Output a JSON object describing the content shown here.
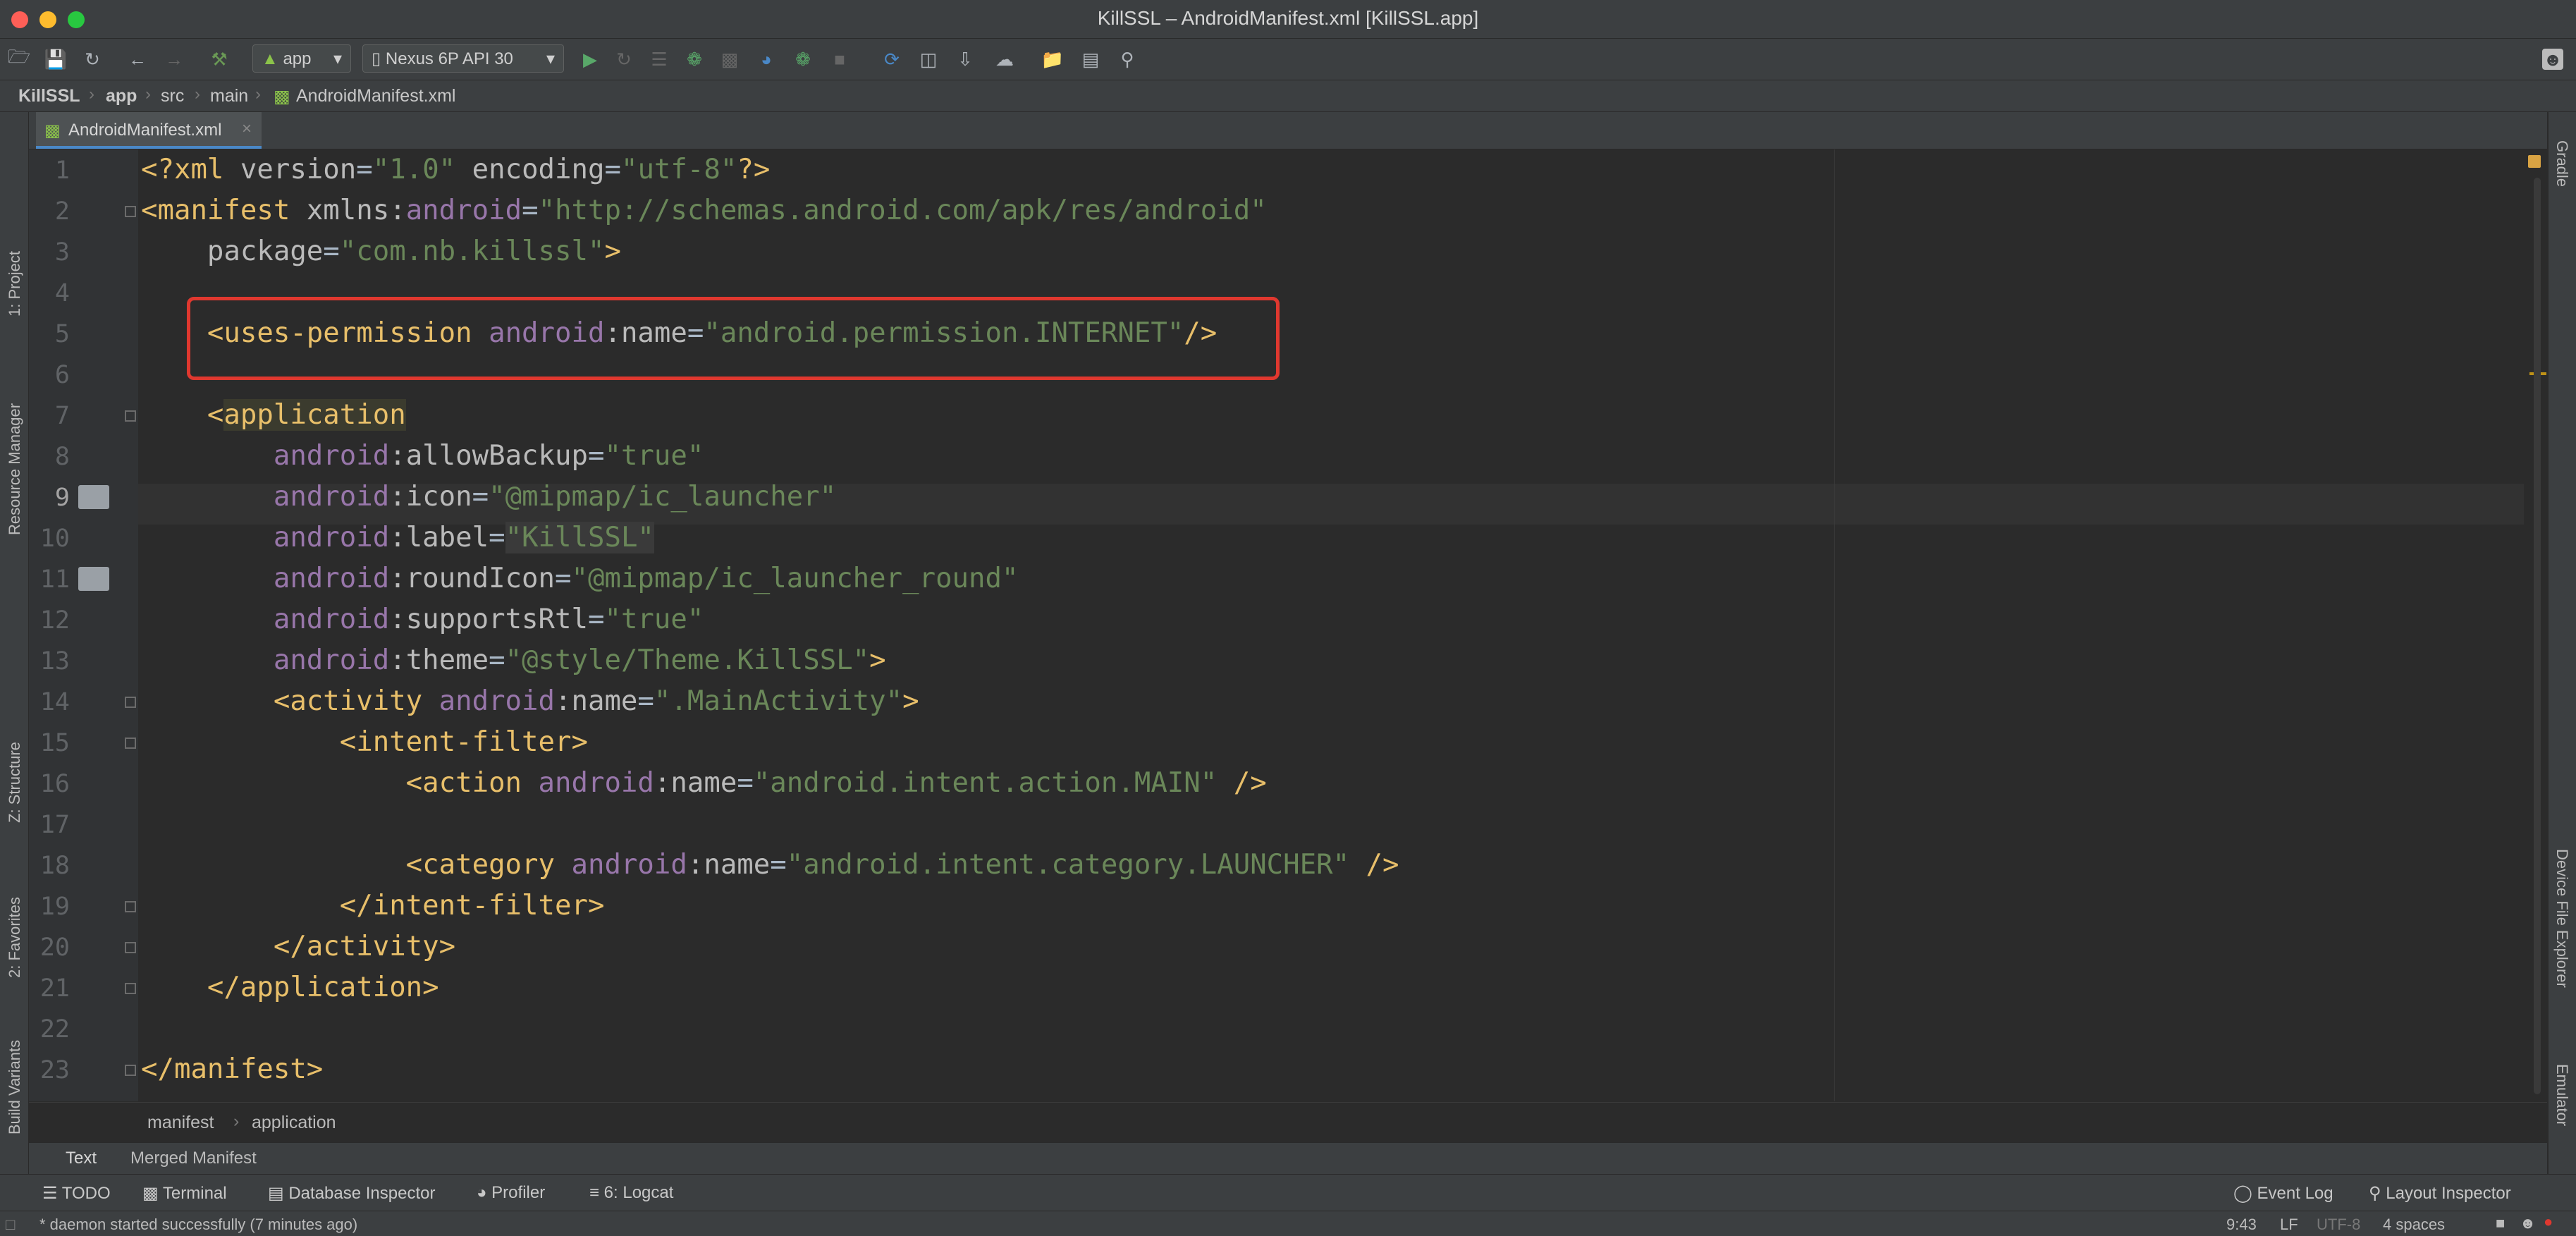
{
  "window": {
    "title": "KillSSL – AndroidManifest.xml [KillSSL.app]"
  },
  "toolbar": {
    "run_config": "app",
    "device": "Nexus 6P API 30"
  },
  "breadcrumb": [
    "KillSSL",
    "app",
    "src",
    "main",
    "AndroidManifest.xml"
  ],
  "left_tools": [
    "1: Project",
    "Resource Manager",
    "Z: Structure",
    "2: Favorites",
    "Build Variants"
  ],
  "right_tools": [
    "Gradle",
    "Device File Explorer",
    "Emulator"
  ],
  "editor_tab": {
    "label": "AndroidManifest.xml"
  },
  "code_lines": [
    {
      "n": "1"
    },
    {
      "n": "2"
    },
    {
      "n": "3"
    },
    {
      "n": "4"
    },
    {
      "n": "5"
    },
    {
      "n": "6"
    },
    {
      "n": "7"
    },
    {
      "n": "8"
    },
    {
      "n": "9"
    },
    {
      "n": "10"
    },
    {
      "n": "11"
    },
    {
      "n": "12"
    },
    {
      "n": "13"
    },
    {
      "n": "14"
    },
    {
      "n": "15"
    },
    {
      "n": "16"
    },
    {
      "n": "17"
    },
    {
      "n": "18"
    },
    {
      "n": "19"
    },
    {
      "n": "20"
    },
    {
      "n": "21"
    },
    {
      "n": "22"
    },
    {
      "n": "23"
    }
  ],
  "code": {
    "l1": {
      "a": "<?xml ",
      "b": "version",
      "c": "=",
      "d": "\"1.0\"",
      "e": " ",
      "f": "encoding",
      "g": "=",
      "h": "\"utf-8\"",
      "i": "?>"
    },
    "l2": {
      "a": "<manifest ",
      "b": "xmlns:",
      "c": "android",
      "d": "=",
      "e": "\"http://schemas.android.com/apk/res/android\""
    },
    "l3": {
      "a": "    ",
      "b": "package",
      "c": "=",
      "d": "\"com.nb.killssl\"",
      "e": ">"
    },
    "l5": {
      "a": "    <uses-permission ",
      "b": "android",
      "c": ":name",
      "d": "=",
      "e": "\"android.permission.INTERNET\"",
      "f": "/>"
    },
    "l7": {
      "a": "    <",
      "b": "application"
    },
    "l8": {
      "a": "        ",
      "b": "android",
      "c": ":allowBackup",
      "d": "=",
      "e": "\"true\""
    },
    "l9": {
      "a": "        ",
      "b": "android",
      "c": ":icon",
      "d": "=",
      "e": "\"@mipmap/ic_launcher\""
    },
    "l10": {
      "a": "        ",
      "b": "android",
      "c": ":label",
      "d": "=",
      "e": "\"KillSSL\""
    },
    "l11": {
      "a": "        ",
      "b": "android",
      "c": ":roundIcon",
      "d": "=",
      "e": "\"@mipmap/ic_launcher_round\""
    },
    "l12": {
      "a": "        ",
      "b": "android",
      "c": ":supportsRtl",
      "d": "=",
      "e": "\"true\""
    },
    "l13": {
      "a": "        ",
      "b": "android",
      "c": ":theme",
      "d": "=",
      "e": "\"@style/Theme.KillSSL\"",
      "f": ">"
    },
    "l14": {
      "a": "        <activity ",
      "b": "android",
      "c": ":name",
      "d": "=",
      "e": "\".MainActivity\"",
      "f": ">"
    },
    "l15": {
      "a": "            <intent-filter>"
    },
    "l16": {
      "a": "                <action ",
      "b": "android",
      "c": ":name",
      "d": "=",
      "e": "\"android.intent.action.MAIN\"",
      "f": " />"
    },
    "l18": {
      "a": "                <category ",
      "b": "android",
      "c": ":name",
      "d": "=",
      "e": "\"android.intent.category.LAUNCHER\"",
      "f": " />"
    },
    "l19": {
      "a": "            </intent-filter>"
    },
    "l20": {
      "a": "        </activity>"
    },
    "l21": {
      "a": "    </application>"
    },
    "l23": {
      "a": "</manifest>"
    }
  },
  "editor_breadcrumb": [
    "manifest",
    "application"
  ],
  "bottom_tabs": {
    "text": "Text",
    "merged": "Merged Manifest"
  },
  "tool_windows": {
    "todo": "TODO",
    "terminal": "Terminal",
    "database": "Database Inspector",
    "profiler": "Profiler",
    "logcat": "6: Logcat",
    "event_log": "Event Log",
    "layout_inspector": "Layout Inspector"
  },
  "status": {
    "message": "* daemon started successfully (7 minutes ago)",
    "position": "9:43",
    "line_sep": "LF",
    "encoding": "UTF-8",
    "indent": "4 spaces"
  },
  "colors": {
    "red_highlight": "#e0382f",
    "tag": "#e8bf6a",
    "string": "#6a8759",
    "namespace": "#9876aa"
  }
}
